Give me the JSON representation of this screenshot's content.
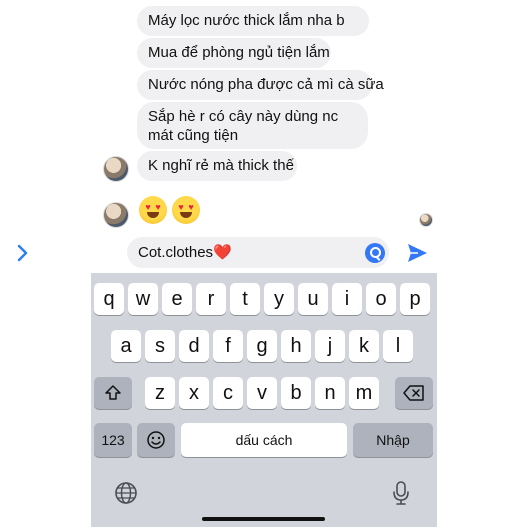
{
  "messages": [
    {
      "text": "Máy lọc nước thick lắm nha b"
    },
    {
      "text": "Mua để phòng ngủ tiện lắm"
    },
    {
      "text": "Nước nóng pha được cả mì cà sữa"
    },
    {
      "text": "Sắp hè r có cây này dùng nc mát cũng tiện"
    },
    {
      "text": "K nghĩ rẻ mà thick thế"
    }
  ],
  "reactions": [
    "heart-eyes-emoji",
    "heart-eyes-emoji"
  ],
  "composer": {
    "text": "Cot.clothes",
    "emoji": "❤️"
  },
  "keyboard": {
    "row1": [
      "q",
      "w",
      "e",
      "r",
      "t",
      "y",
      "u",
      "i",
      "o",
      "p"
    ],
    "row2": [
      "a",
      "s",
      "d",
      "f",
      "g",
      "h",
      "j",
      "k",
      "l"
    ],
    "row3": [
      "z",
      "x",
      "c",
      "v",
      "b",
      "n",
      "m"
    ],
    "numbers_label": "123",
    "space_label": "dấu cách",
    "return_label": "Nhập"
  },
  "icons": {
    "expand": "chevron-right-icon",
    "search": "search-icon",
    "send": "send-icon",
    "shift": "shift-icon",
    "delete": "delete-icon",
    "emoji": "emoji-icon",
    "globe": "globe-icon",
    "mic": "microphone-icon"
  },
  "colors": {
    "accent": "#3478f6",
    "bubble": "#f0f0f2",
    "keyboard_bg": "#d1d4da"
  }
}
